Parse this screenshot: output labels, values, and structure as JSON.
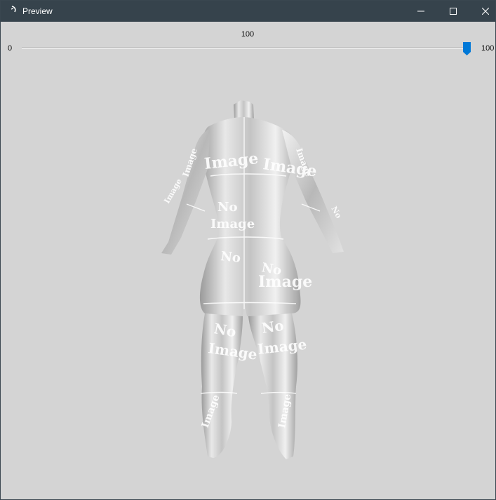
{
  "window": {
    "title": "Preview",
    "controls": {
      "minimize": "minimize",
      "maximize": "maximize",
      "close": "close"
    }
  },
  "slider": {
    "value": "100",
    "min_label": "0",
    "max_label": "100",
    "fraction": 1.0,
    "accent": "#0078d7"
  },
  "preview": {
    "texture_text": [
      "No",
      "Image"
    ],
    "surface_color": "#e6e6e6"
  },
  "colors": {
    "titlebar": "#36434c",
    "background": "#d4d4d4"
  },
  "icons": {
    "app": "preview-app-icon",
    "minimize": "minimize-icon",
    "maximize": "maximize-icon",
    "close": "close-icon"
  }
}
